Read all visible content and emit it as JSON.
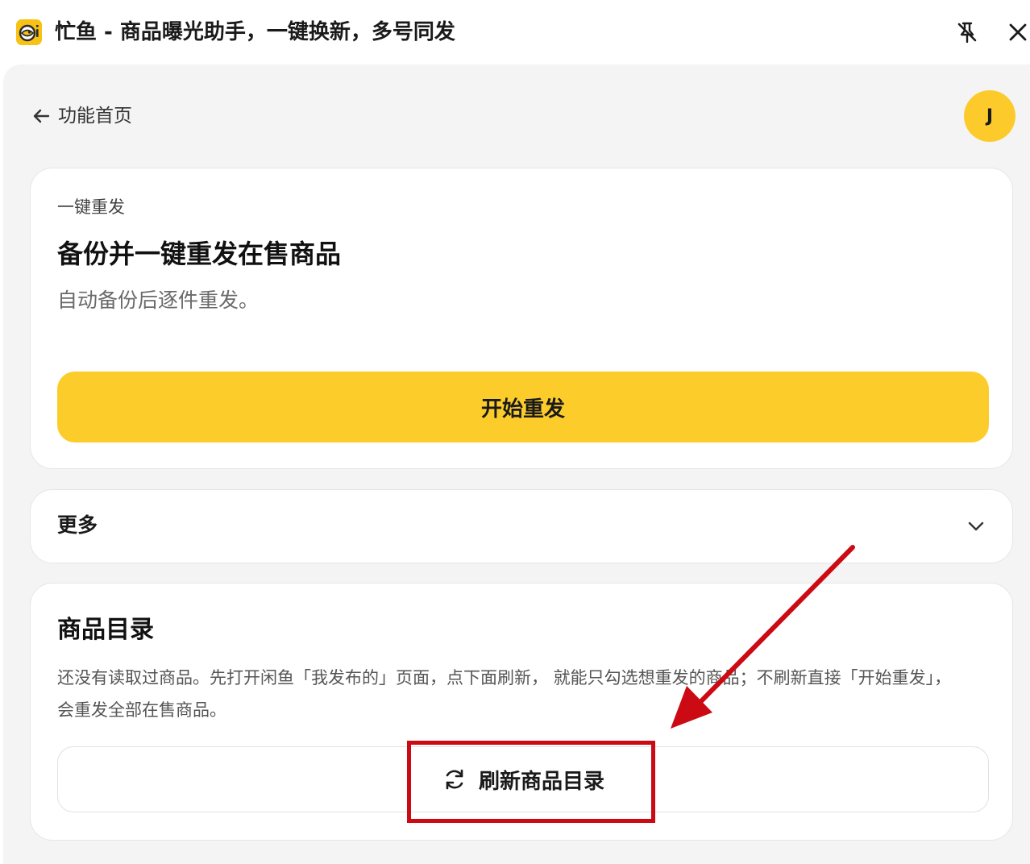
{
  "window": {
    "title": "忙鱼 - 商品曝光助手，一键换新，多号同发",
    "app_icon": "fish-logo-icon",
    "pin_icon": "pin-off-icon",
    "close_icon": "close-icon"
  },
  "nav": {
    "back_label": "功能首页",
    "avatar_initial": "J"
  },
  "repost_card": {
    "eyebrow": "一键重发",
    "headline": "备份并一键重发在售商品",
    "subtitle": "自动备份后逐件重发。",
    "primary_button": "开始重发"
  },
  "more_card": {
    "label": "更多"
  },
  "catalog_card": {
    "title": "商品目录",
    "description": "还没有读取过商品。先打开闲鱼「我发布的」页面，点下面刷新， 就能只勾选想重发的商品；不刷新直接「开始重发」，会重发全部在售商品。",
    "refresh_button": "刷新商品目录"
  },
  "colors": {
    "accent": "#fccd2a",
    "panel_bg": "#f4f4f4",
    "annotation": "#cc0a14"
  }
}
